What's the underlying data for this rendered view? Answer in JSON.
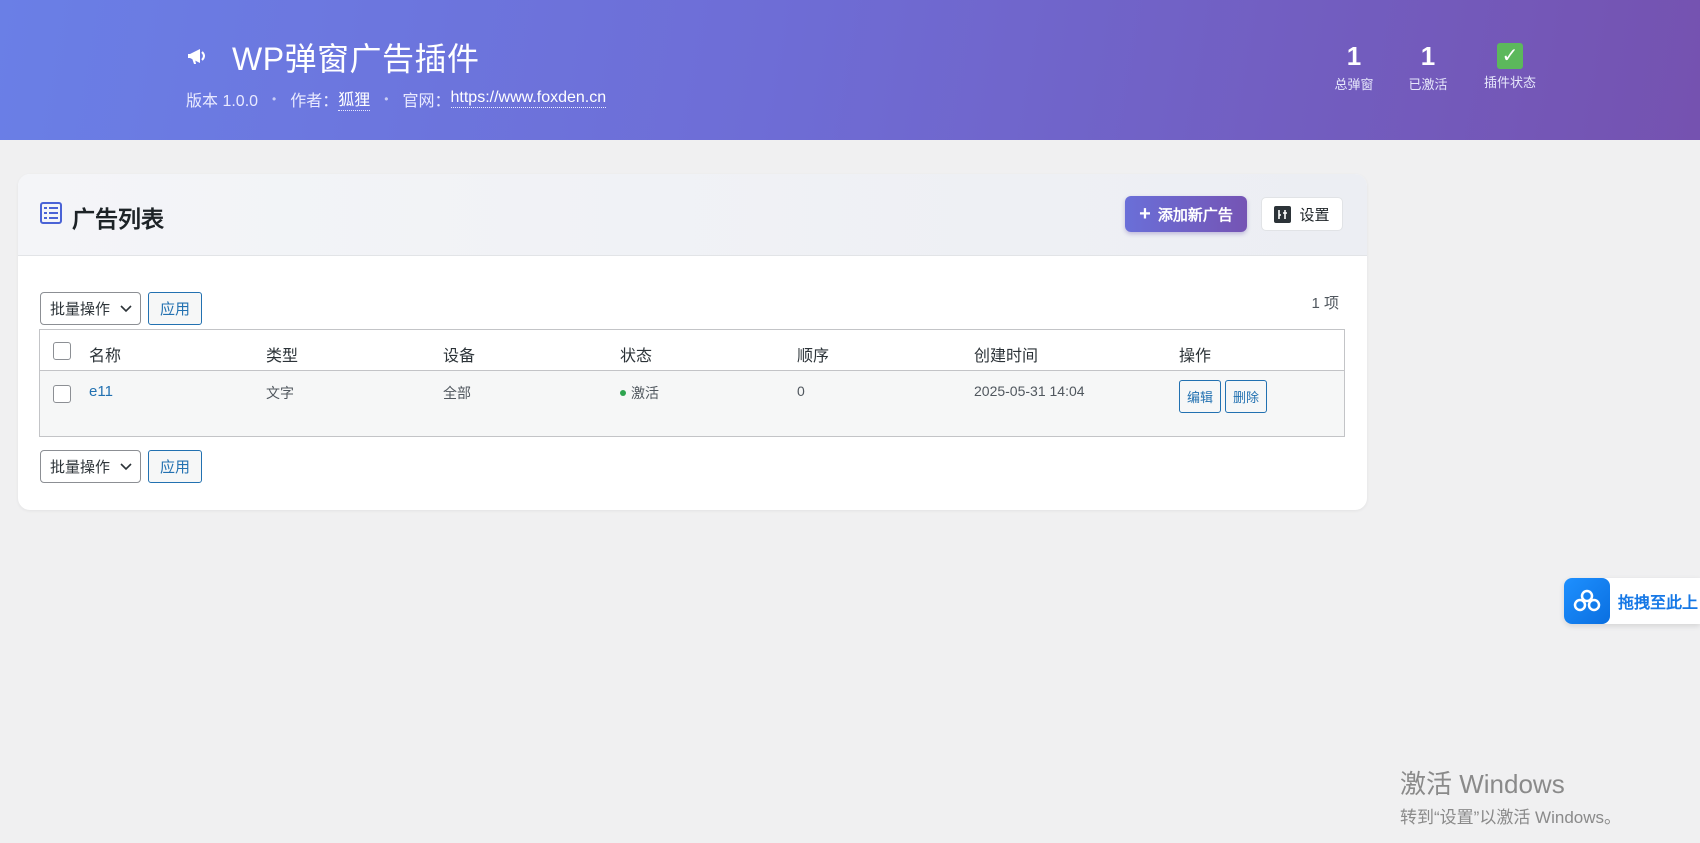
{
  "header": {
    "title": "WP弹窗广告插件",
    "version": "版本 1.0.0",
    "author_label": "作者：",
    "author": "狐狸",
    "site_label": "官网：",
    "site": "https://www.foxden.cn",
    "stats": [
      {
        "value": "1",
        "label": "总弹窗"
      },
      {
        "value": "1",
        "label": "已激活"
      },
      {
        "value": "✓",
        "label": "插件状态"
      }
    ]
  },
  "card": {
    "title": "广告列表",
    "add_button": "添加新广告",
    "settings_button": "设置",
    "bulk_action": "批量操作",
    "apply": "应用",
    "count": "1 项",
    "columns": [
      "名称",
      "类型",
      "设备",
      "状态",
      "顺序",
      "创建时间",
      "操作"
    ],
    "rows": [
      {
        "name": "e11",
        "type": "文字",
        "device": "全部",
        "status": "激活",
        "order": "0",
        "created": "2025-05-31 14:04",
        "edit": "编辑",
        "delete": "删除"
      }
    ]
  },
  "widget": {
    "text": "拖拽至此上"
  },
  "watermark": {
    "line1": "激活 Windows",
    "line2": "转到“设置”以激活 Windows。"
  },
  "colors": {
    "banner_start": "#6a7fe6",
    "banner_end": "#7552b0",
    "link": "#2271b1",
    "status_active": "#2ea44f",
    "check_green": "#5cb85c"
  }
}
